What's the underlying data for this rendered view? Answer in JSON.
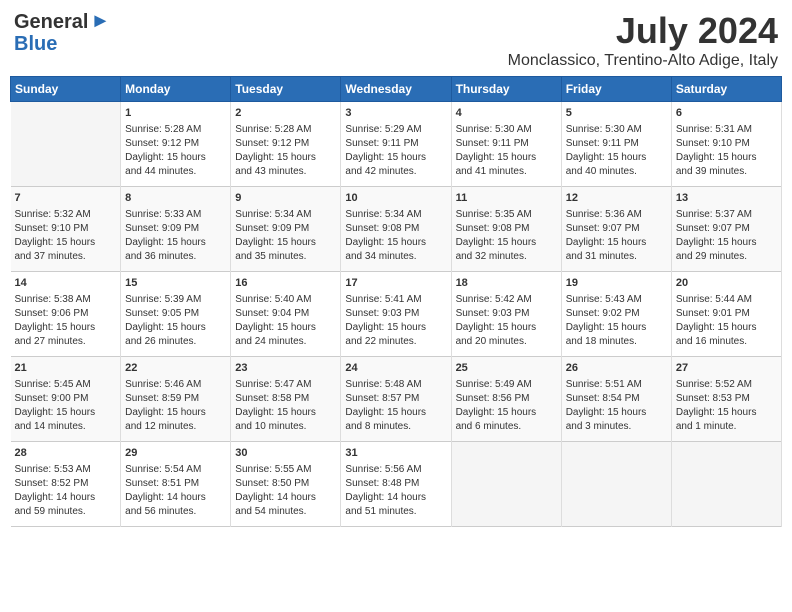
{
  "header": {
    "logo_line1": "General",
    "logo_line2": "Blue",
    "month_year": "July 2024",
    "location": "Monclassico, Trentino-Alto Adige, Italy"
  },
  "weekdays": [
    "Sunday",
    "Monday",
    "Tuesday",
    "Wednesday",
    "Thursday",
    "Friday",
    "Saturday"
  ],
  "weeks": [
    [
      {
        "day": "",
        "content": ""
      },
      {
        "day": "1",
        "content": "Sunrise: 5:28 AM\nSunset: 9:12 PM\nDaylight: 15 hours\nand 44 minutes."
      },
      {
        "day": "2",
        "content": "Sunrise: 5:28 AM\nSunset: 9:12 PM\nDaylight: 15 hours\nand 43 minutes."
      },
      {
        "day": "3",
        "content": "Sunrise: 5:29 AM\nSunset: 9:11 PM\nDaylight: 15 hours\nand 42 minutes."
      },
      {
        "day": "4",
        "content": "Sunrise: 5:30 AM\nSunset: 9:11 PM\nDaylight: 15 hours\nand 41 minutes."
      },
      {
        "day": "5",
        "content": "Sunrise: 5:30 AM\nSunset: 9:11 PM\nDaylight: 15 hours\nand 40 minutes."
      },
      {
        "day": "6",
        "content": "Sunrise: 5:31 AM\nSunset: 9:10 PM\nDaylight: 15 hours\nand 39 minutes."
      }
    ],
    [
      {
        "day": "7",
        "content": "Sunrise: 5:32 AM\nSunset: 9:10 PM\nDaylight: 15 hours\nand 37 minutes."
      },
      {
        "day": "8",
        "content": "Sunrise: 5:33 AM\nSunset: 9:09 PM\nDaylight: 15 hours\nand 36 minutes."
      },
      {
        "day": "9",
        "content": "Sunrise: 5:34 AM\nSunset: 9:09 PM\nDaylight: 15 hours\nand 35 minutes."
      },
      {
        "day": "10",
        "content": "Sunrise: 5:34 AM\nSunset: 9:08 PM\nDaylight: 15 hours\nand 34 minutes."
      },
      {
        "day": "11",
        "content": "Sunrise: 5:35 AM\nSunset: 9:08 PM\nDaylight: 15 hours\nand 32 minutes."
      },
      {
        "day": "12",
        "content": "Sunrise: 5:36 AM\nSunset: 9:07 PM\nDaylight: 15 hours\nand 31 minutes."
      },
      {
        "day": "13",
        "content": "Sunrise: 5:37 AM\nSunset: 9:07 PM\nDaylight: 15 hours\nand 29 minutes."
      }
    ],
    [
      {
        "day": "14",
        "content": "Sunrise: 5:38 AM\nSunset: 9:06 PM\nDaylight: 15 hours\nand 27 minutes."
      },
      {
        "day": "15",
        "content": "Sunrise: 5:39 AM\nSunset: 9:05 PM\nDaylight: 15 hours\nand 26 minutes."
      },
      {
        "day": "16",
        "content": "Sunrise: 5:40 AM\nSunset: 9:04 PM\nDaylight: 15 hours\nand 24 minutes."
      },
      {
        "day": "17",
        "content": "Sunrise: 5:41 AM\nSunset: 9:03 PM\nDaylight: 15 hours\nand 22 minutes."
      },
      {
        "day": "18",
        "content": "Sunrise: 5:42 AM\nSunset: 9:03 PM\nDaylight: 15 hours\nand 20 minutes."
      },
      {
        "day": "19",
        "content": "Sunrise: 5:43 AM\nSunset: 9:02 PM\nDaylight: 15 hours\nand 18 minutes."
      },
      {
        "day": "20",
        "content": "Sunrise: 5:44 AM\nSunset: 9:01 PM\nDaylight: 15 hours\nand 16 minutes."
      }
    ],
    [
      {
        "day": "21",
        "content": "Sunrise: 5:45 AM\nSunset: 9:00 PM\nDaylight: 15 hours\nand 14 minutes."
      },
      {
        "day": "22",
        "content": "Sunrise: 5:46 AM\nSunset: 8:59 PM\nDaylight: 15 hours\nand 12 minutes."
      },
      {
        "day": "23",
        "content": "Sunrise: 5:47 AM\nSunset: 8:58 PM\nDaylight: 15 hours\nand 10 minutes."
      },
      {
        "day": "24",
        "content": "Sunrise: 5:48 AM\nSunset: 8:57 PM\nDaylight: 15 hours\nand 8 minutes."
      },
      {
        "day": "25",
        "content": "Sunrise: 5:49 AM\nSunset: 8:56 PM\nDaylight: 15 hours\nand 6 minutes."
      },
      {
        "day": "26",
        "content": "Sunrise: 5:51 AM\nSunset: 8:54 PM\nDaylight: 15 hours\nand 3 minutes."
      },
      {
        "day": "27",
        "content": "Sunrise: 5:52 AM\nSunset: 8:53 PM\nDaylight: 15 hours\nand 1 minute."
      }
    ],
    [
      {
        "day": "28",
        "content": "Sunrise: 5:53 AM\nSunset: 8:52 PM\nDaylight: 14 hours\nand 59 minutes."
      },
      {
        "day": "29",
        "content": "Sunrise: 5:54 AM\nSunset: 8:51 PM\nDaylight: 14 hours\nand 56 minutes."
      },
      {
        "day": "30",
        "content": "Sunrise: 5:55 AM\nSunset: 8:50 PM\nDaylight: 14 hours\nand 54 minutes."
      },
      {
        "day": "31",
        "content": "Sunrise: 5:56 AM\nSunset: 8:48 PM\nDaylight: 14 hours\nand 51 minutes."
      },
      {
        "day": "",
        "content": ""
      },
      {
        "day": "",
        "content": ""
      },
      {
        "day": "",
        "content": ""
      }
    ]
  ]
}
